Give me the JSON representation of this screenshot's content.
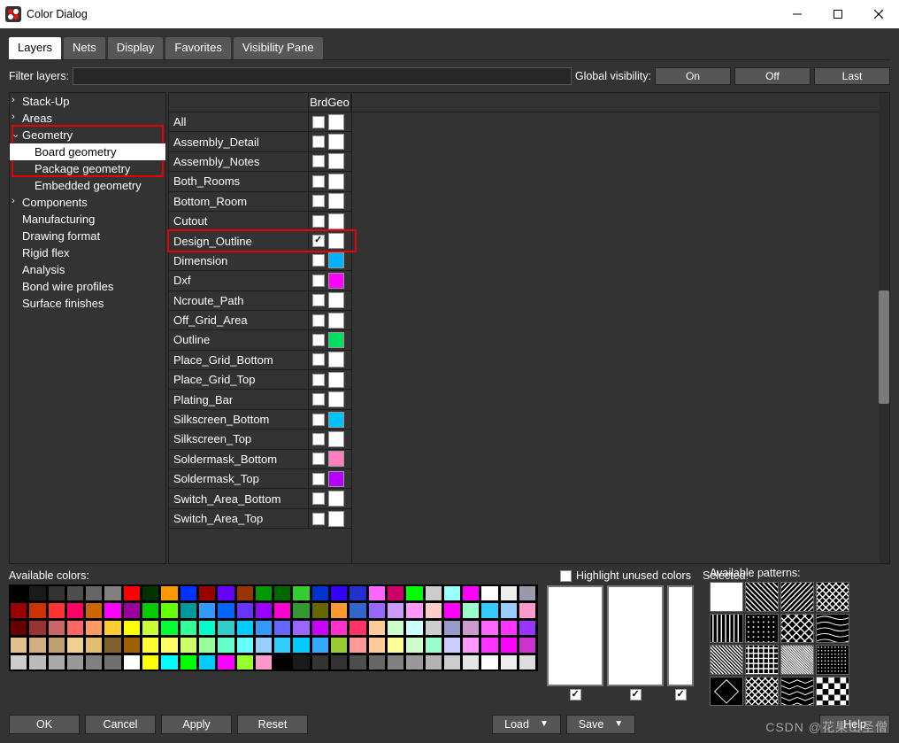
{
  "window": {
    "title": "Color Dialog"
  },
  "tabs": [
    "Layers",
    "Nets",
    "Display",
    "Favorites",
    "Visibility Pane"
  ],
  "filter_label": "Filter layers:",
  "filter_value": "",
  "global_vis_label": "Global visibility:",
  "global_vis_btns": [
    "On",
    "Off",
    "Last"
  ],
  "tree": [
    {
      "label": "Stack-Up",
      "lvl": 0,
      "chev": "›"
    },
    {
      "label": "Areas",
      "lvl": 0,
      "chev": "›"
    },
    {
      "label": "Geometry",
      "lvl": 0,
      "chev": "⌄",
      "inred": true
    },
    {
      "label": "Board geometry",
      "lvl": 1,
      "sel": true,
      "inred": true
    },
    {
      "label": "Package geometry",
      "lvl": 1,
      "inred_partial": true
    },
    {
      "label": "Embedded geometry",
      "lvl": 1
    },
    {
      "label": "Components",
      "lvl": 0,
      "chev": "›"
    },
    {
      "label": "Manufacturing",
      "lvl": 0
    },
    {
      "label": "Drawing format",
      "lvl": 0
    },
    {
      "label": "Rigid flex",
      "lvl": 0
    },
    {
      "label": "Analysis",
      "lvl": 0
    },
    {
      "label": "Bond wire profiles",
      "lvl": 0
    },
    {
      "label": "Surface finishes",
      "lvl": 0
    }
  ],
  "grid": {
    "header": "BrdGeo",
    "rows": [
      {
        "name": "All",
        "checked": false,
        "color": "#ffffff"
      },
      {
        "name": "Assembly_Detail",
        "checked": false,
        "color": "#ffffff"
      },
      {
        "name": "Assembly_Notes",
        "checked": false,
        "color": "#ffffff"
      },
      {
        "name": "Both_Rooms",
        "checked": false,
        "color": "#ffffff"
      },
      {
        "name": "Bottom_Room",
        "checked": false,
        "color": "#ffffff"
      },
      {
        "name": "Cutout",
        "checked": false,
        "color": "#ffffff"
      },
      {
        "name": "Design_Outline",
        "checked": true,
        "color": "#ffffff",
        "highlight": true
      },
      {
        "name": "Dimension",
        "checked": false,
        "color": "#00b2ff"
      },
      {
        "name": "Dxf",
        "checked": false,
        "color": "#ff00ff"
      },
      {
        "name": "Ncroute_Path",
        "checked": false,
        "color": "#ffffff"
      },
      {
        "name": "Off_Grid_Area",
        "checked": false,
        "color": "#ffffff"
      },
      {
        "name": "Outline",
        "checked": false,
        "color": "#00e060"
      },
      {
        "name": "Place_Grid_Bottom",
        "checked": false,
        "color": "#ffffff"
      },
      {
        "name": "Place_Grid_Top",
        "checked": false,
        "color": "#ffffff"
      },
      {
        "name": "Plating_Bar",
        "checked": false,
        "color": "#ffffff"
      },
      {
        "name": "Silkscreen_Bottom",
        "checked": false,
        "color": "#00c0ff"
      },
      {
        "name": "Silkscreen_Top",
        "checked": false,
        "color": "#ffffff"
      },
      {
        "name": "Soldermask_Bottom",
        "checked": false,
        "color": "#ff7fbf"
      },
      {
        "name": "Soldermask_Top",
        "checked": false,
        "color": "#b300ff"
      },
      {
        "name": "Switch_Area_Bottom",
        "checked": false,
        "color": "#ffffff"
      },
      {
        "name": "Switch_Area_Top",
        "checked": false,
        "color": "#ffffff"
      }
    ]
  },
  "avail_colors_label": "Available colors:",
  "hunused_label": "Highlight unused colors",
  "selected_label": "Selected:",
  "patterns_label": "Available patterns:",
  "palette": [
    [
      "#000000",
      "#1a1a1a",
      "#333333",
      "#4d4d4d",
      "#666666",
      "#808080",
      "#ff0000",
      "#003300",
      "#ff9900",
      "#0033ff",
      "#990000",
      "#6600ff",
      "#993300",
      "#009900",
      "#006600",
      "#33cc33",
      "#0033cc",
      "#3300ff",
      "#2233cc",
      "#ff66ff",
      "#cc0066",
      "#00ff00",
      "#cccccc",
      "#99ffff",
      "#ff00ff",
      "#ffffff",
      "#eeeeee",
      "#9999aa"
    ],
    [
      "#990000",
      "#cc3300",
      "#ff3333",
      "#ff0066",
      "#cc6600",
      "#ff00ff",
      "#990099",
      "#00cc00",
      "#66ff00",
      "#009999",
      "#3399ff",
      "#0066ff",
      "#6633ff",
      "#9900ff",
      "#ff00cc",
      "#339933",
      "#666600",
      "#ff9933",
      "#3366cc",
      "#9966ff",
      "#cc99ff",
      "#ff99ff",
      "#ffcccc",
      "#ff00ff",
      "#99ffcc",
      "#33ccff",
      "#99ccff",
      "#ff99cc"
    ],
    [
      "#660000",
      "#993333",
      "#cc6666",
      "#ff6666",
      "#ff9966",
      "#ffcc33",
      "#ffff00",
      "#ccff33",
      "#00ff33",
      "#33ff99",
      "#00ffcc",
      "#33cccc",
      "#00ccff",
      "#3399ff",
      "#6666ff",
      "#9966ff",
      "#cc00ff",
      "#ff33cc",
      "#ff3366",
      "#ffcc99",
      "#ccffcc",
      "#ccffff",
      "#cccccc",
      "#9999cc",
      "#cc99cc",
      "#ff66ff",
      "#ff33ff",
      "#9933ff"
    ],
    [
      "#e0c090",
      "#d0b080",
      "#c0a070",
      "#f0d090",
      "#e0c070",
      "#806030",
      "#a06000",
      "#ffff33",
      "#ffff66",
      "#ccff66",
      "#99ff99",
      "#66ffcc",
      "#66ffff",
      "#99ccff",
      "#33ccff",
      "#00ccff",
      "#33aaff",
      "#99cc33",
      "#ff9999",
      "#ffcc99",
      "#ffff99",
      "#ccffcc",
      "#99ffcc",
      "#ccccff",
      "#ff99ff",
      "#ff33ff",
      "#ff00ff",
      "#cc33cc"
    ],
    [
      "#cccccc",
      "#bbbbbb",
      "#aaaaaa",
      "#999999",
      "#808080",
      "#707070",
      "#ffffff",
      "#ffff00",
      "#00ffff",
      "#00ff00",
      "#00ccff",
      "#ff00ff",
      "#99ff33",
      "#ff99cc",
      "#000000",
      "#1a1a1a",
      "#333333",
      "#333333",
      "#4d4d4d",
      "#666666",
      "#808080",
      "#999999",
      "#b3b3b3",
      "#cccccc",
      "#e6e6e6",
      "#ffffff",
      "#eeeeee",
      "#dddddd"
    ]
  ],
  "dlg_btns": {
    "ok": "OK",
    "cancel": "Cancel",
    "apply": "Apply",
    "reset": "Reset",
    "load": "Load",
    "save": "Save",
    "help": "Help"
  },
  "watermark": "CSDN @花果山圣僧"
}
